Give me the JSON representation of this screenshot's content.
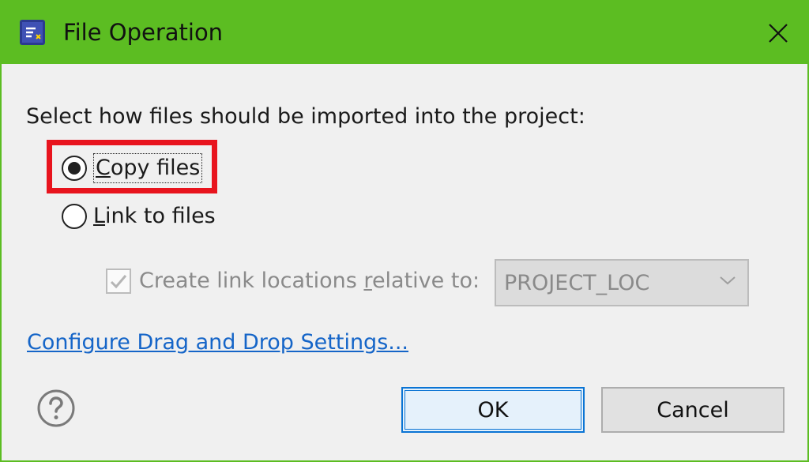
{
  "window": {
    "title": "File Operation",
    "app_icon": "eclipse-ide-icon",
    "close_icon": "close-icon",
    "accent_color": "#5cbd22"
  },
  "prompt": "Select how files should be imported into the project:",
  "options": {
    "copy": {
      "label_pre": "",
      "label_mnemonic": "C",
      "label_post": "opy files",
      "selected": true
    },
    "link": {
      "label_pre": "",
      "label_mnemonic": "L",
      "label_post": "ink to files",
      "selected": false
    }
  },
  "relative": {
    "label_pre": "Create link locations ",
    "label_mnemonic": "r",
    "label_post": "elative to:",
    "checked": true,
    "enabled": false,
    "variable": "PROJECT_LOC"
  },
  "settings_link": "Configure Drag and Drop Settings...",
  "buttons": {
    "help_icon": "help-icon",
    "ok": "OK",
    "cancel": "Cancel"
  },
  "highlight_color": "#e8141e"
}
